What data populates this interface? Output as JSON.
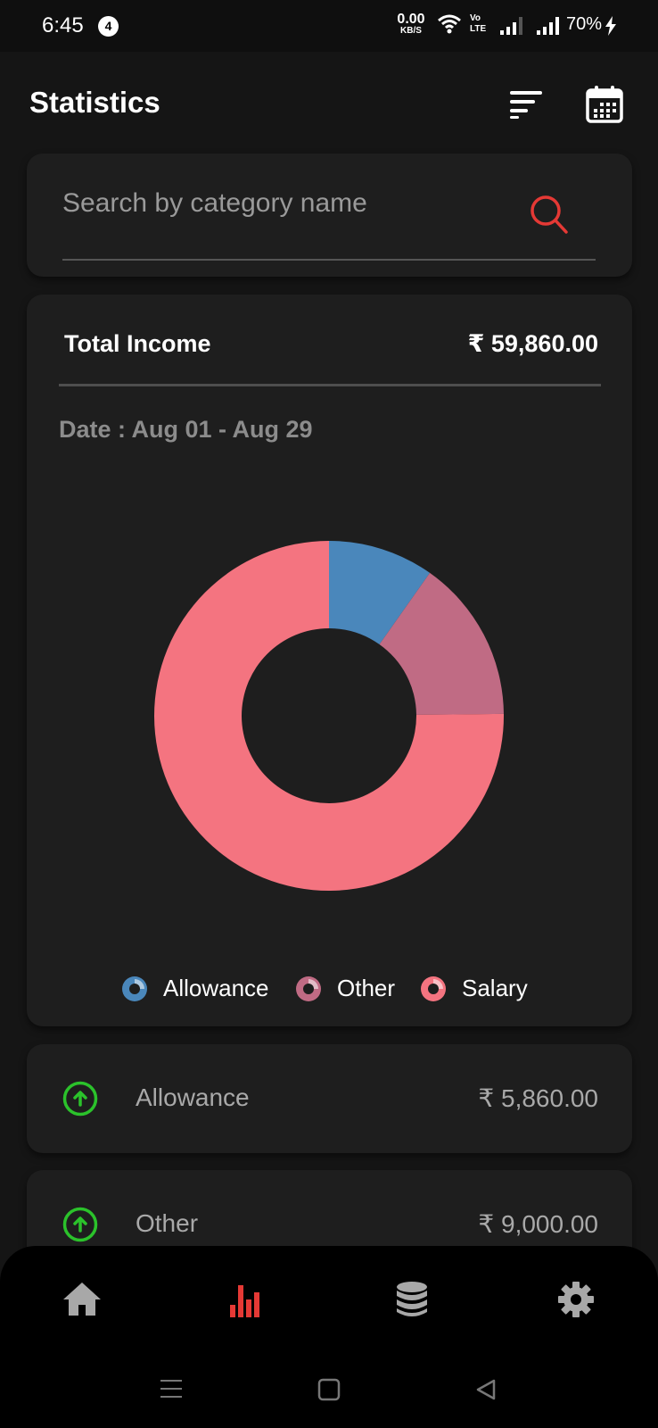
{
  "status_bar": {
    "time": "6:45",
    "notification_count": "4",
    "net_speed_value": "0.00",
    "net_speed_unit": "KB/S",
    "volte_line1": "Vo",
    "volte_line2": "LTE",
    "battery": "70%"
  },
  "header": {
    "title": "Statistics",
    "sort_icon": "sort-icon",
    "calendar_icon": "calendar-icon"
  },
  "search": {
    "placeholder": "Search by category name",
    "value": "",
    "icon": "search-icon",
    "icon_color": "#e53935"
  },
  "summary": {
    "label": "Total Income",
    "value": "₹ 59,860.00",
    "date_range": "Date : Aug 01 - Aug 29"
  },
  "chart_data": {
    "type": "pie",
    "style": "donut",
    "categories": [
      "Allowance",
      "Other",
      "Salary"
    ],
    "values": [
      5860,
      9000,
      45000
    ],
    "colors": [
      "#4a87bb",
      "#c06b84",
      "#f47480"
    ],
    "legend_position": "bottom"
  },
  "legend": [
    {
      "label": "Allowance",
      "color": "#4a87bb"
    },
    {
      "label": "Other",
      "color": "#c06b84"
    },
    {
      "label": "Salary",
      "color": "#f47480"
    }
  ],
  "transactions": [
    {
      "category": "Allowance",
      "amount": "₹ 5,860.00",
      "icon": "arrow-up-circle-icon",
      "icon_color": "#2bc22b"
    },
    {
      "category": "Other",
      "amount": "₹ 9,000.00",
      "icon": "arrow-up-circle-icon",
      "icon_color": "#2bc22b"
    }
  ],
  "bottom_nav": {
    "items": [
      {
        "icon": "home-icon",
        "active": false
      },
      {
        "icon": "bar-chart-icon",
        "active": true
      },
      {
        "icon": "database-icon",
        "active": false
      },
      {
        "icon": "settings-icon",
        "active": false
      }
    ],
    "active_color": "#e53935",
    "inactive_color": "#a8a8a8"
  }
}
